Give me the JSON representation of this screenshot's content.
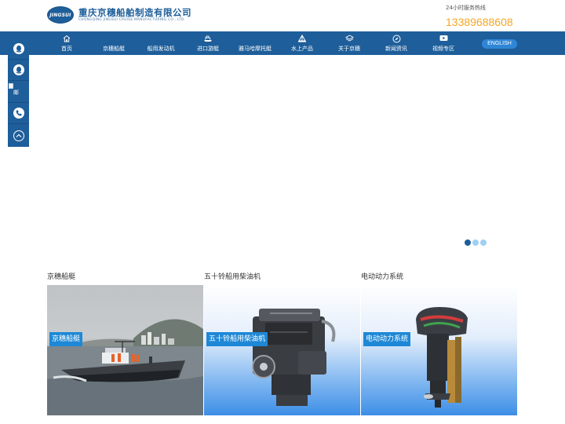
{
  "header": {
    "logo_badge": "JINGSUI",
    "company_name_cn": "重庆京穗船舶制造有限公司",
    "company_name_en": "CHONGQING JINGSUI CRUISE MANUFACTURING CO., LTD.",
    "hotline_label": "24小时服务热线",
    "hotline_number": "13389688608"
  },
  "nav": {
    "items": [
      {
        "label": "首页",
        "icon": "home-icon"
      },
      {
        "label": "京穗船艇",
        "icon": ""
      },
      {
        "label": "船用发动机",
        "icon": ""
      },
      {
        "label": "进口游艇",
        "icon": "yacht-icon"
      },
      {
        "label": "雅马哈摩托艇",
        "icon": ""
      },
      {
        "label": "水上产品",
        "icon": "sailboat-icon"
      },
      {
        "label": "关于京穗",
        "icon": "layers-icon"
      },
      {
        "label": "新闻资讯",
        "icon": "compass-icon"
      },
      {
        "label": "视频专区",
        "icon": "video-icon"
      }
    ],
    "lang_button": "ENGLISH"
  },
  "float_bar": {
    "items": [
      "qq-icon",
      "qq-icon",
      "mail-icon",
      "phone-icon",
      "back-to-top-icon"
    ],
    "mail_text": "邮"
  },
  "banner": {
    "slide_count": 3,
    "active_slide": 1
  },
  "sections": [
    {
      "title": "京穗船艇",
      "label": "京穗船艇",
      "image": "boat-photo"
    },
    {
      "title": "五十铃船用柴油机",
      "label": "五十铃船用柴油机",
      "image": "diesel-engine-photo"
    },
    {
      "title": "电动动力系统",
      "label": "电动动力系统",
      "image": "outboard-motor-photo"
    }
  ],
  "colors": {
    "brand_blue": "#1e5e9a",
    "hotline_orange": "#f5a623",
    "label_blue": "#1e88d6"
  }
}
